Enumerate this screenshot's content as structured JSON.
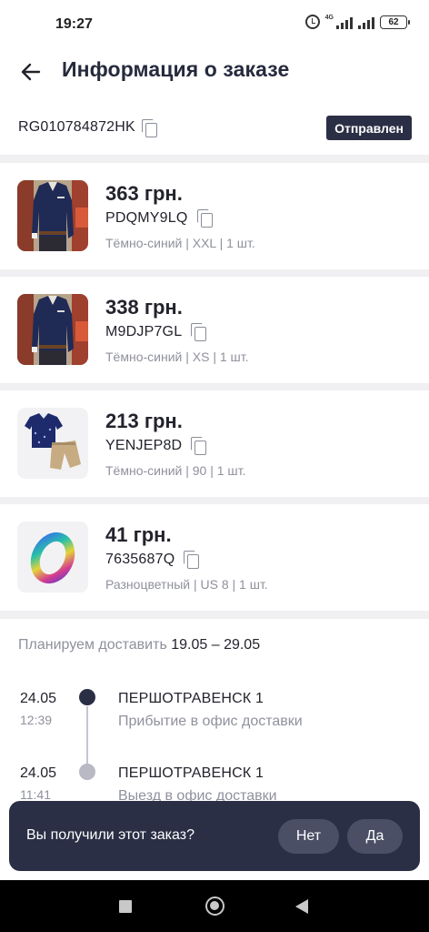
{
  "status_bar": {
    "time": "19:27",
    "network": "4G",
    "battery": "62"
  },
  "header": {
    "title": "Информация о заказе"
  },
  "order": {
    "id": "RG010784872HK",
    "status": "Отправлен"
  },
  "products": [
    {
      "price": "363 грн.",
      "sku": "PDQMY9LQ",
      "variant": "Тёмно-синий | XXL | 1 шт.",
      "image": "navy-shirt"
    },
    {
      "price": "338 грн.",
      "sku": "M9DJP7GL",
      "variant": "Тёмно-синий | XS | 1 шт.",
      "image": "navy-shirt"
    },
    {
      "price": "213 грн.",
      "sku": "YENJEP8D",
      "variant": "Тёмно-синий | 90 | 1 шт.",
      "image": "kids-polo-shorts-set"
    },
    {
      "price": "41 грн.",
      "sku": "7635687Q",
      "variant": "Разноцветный | US 8 | 1 шт.",
      "image": "rainbow-ring"
    }
  ],
  "delivery": {
    "plan_label": "Планируем доставить",
    "plan_dates": "19.05 – 29.05",
    "events": [
      {
        "date": "24.05",
        "time": "12:39",
        "city": "ПЕРШОТРАВЕНСК 1",
        "description": "Прибытие в офис доставки",
        "active": true
      },
      {
        "date": "24.05",
        "time": "11:41",
        "city": "ПЕРШОТРАВЕНСК 1",
        "description": "Выезд в офис доставки",
        "active": false
      }
    ]
  },
  "prompt": {
    "question": "Вы получили этот заказ?",
    "no_label": "Нет",
    "yes_label": "Да"
  },
  "colors": {
    "accent_dark": "#2b2f45",
    "muted_text": "#8f919c",
    "timeline_active": "#2b2f45",
    "timeline_inactive": "#b8b9c4"
  }
}
